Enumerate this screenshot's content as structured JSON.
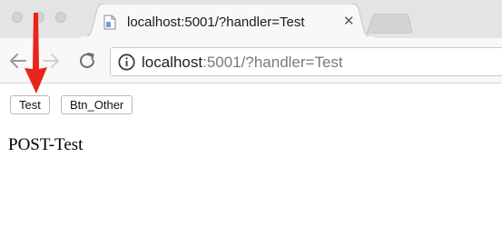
{
  "tab": {
    "title": "localhost:5001/?handler=Test",
    "close_label": "✕"
  },
  "address_bar": {
    "host": "localhost",
    "rest": ":5001/?handler=Test"
  },
  "page": {
    "buttons": [
      {
        "label": "Test"
      },
      {
        "label": "Btn_Other"
      }
    ],
    "result_text": "POST-Test"
  },
  "colors": {
    "annotation_arrow": "#e8241c",
    "tab_strip": "#e4e4e4",
    "toolbar": "#f8f8f8"
  },
  "icons": {
    "tab_favicon": "page-icon",
    "back": "arrow-left-icon",
    "forward": "arrow-right-icon",
    "reload": "reload-icon",
    "site_info": "info-icon",
    "annotation": "red-arrow-down-icon"
  }
}
